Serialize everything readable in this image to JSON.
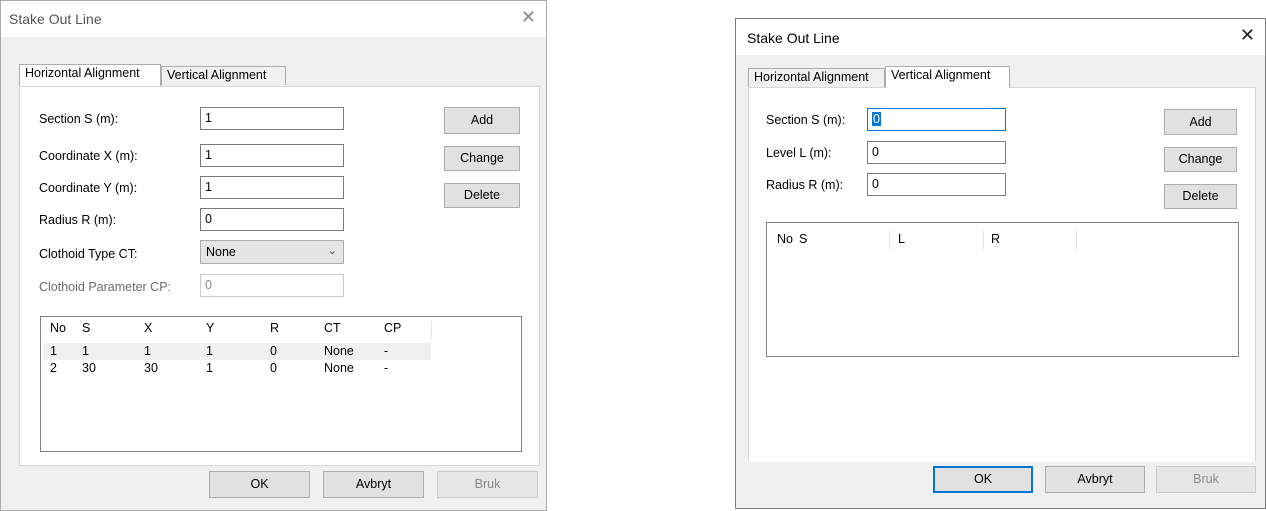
{
  "left": {
    "title": "Stake Out Line",
    "close_glyph": "✕",
    "tabs": [
      "Horizontal Alignment",
      "Vertical Alignment"
    ],
    "fields": {
      "section_label": "Section S (m):",
      "section_value": "1",
      "cx_label": "Coordinate X (m):",
      "cx_value": "1",
      "cy_label": "Coordinate Y (m):",
      "cy_value": "1",
      "radius_label": "Radius R (m):",
      "radius_value": "0",
      "ct_label": "Clothoid Type CT:",
      "ct_value": "None",
      "cp_label": "Clothoid Parameter CP:",
      "cp_value": "0"
    },
    "buttons": {
      "add": "Add",
      "change": "Change",
      "delete": "Delete"
    },
    "table": {
      "columns": [
        "No",
        "S",
        "X",
        "Y",
        "R",
        "CT",
        "CP"
      ],
      "rows": [
        [
          "1",
          "1",
          "1",
          "1",
          "0",
          "None",
          "-"
        ],
        [
          "2",
          "30",
          "30",
          "1",
          "0",
          "None",
          "-"
        ]
      ]
    },
    "footer": {
      "ok": "OK",
      "cancel": "Avbryt",
      "apply": "Bruk"
    }
  },
  "right": {
    "title": "Stake Out Line",
    "close_glyph": "✕",
    "tabs": [
      "Horizontal Alignment",
      "Vertical Alignment"
    ],
    "fields": {
      "section_label": "Section S (m):",
      "section_value": "0",
      "level_label": "Level L (m):",
      "level_value": "0",
      "radius_label": "Radius R (m):",
      "radius_value": "0"
    },
    "buttons": {
      "add": "Add",
      "change": "Change",
      "delete": "Delete"
    },
    "table": {
      "columns": [
        "No",
        "S",
        "L",
        "R"
      ]
    },
    "footer": {
      "ok": "OK",
      "cancel": "Avbryt",
      "apply": "Bruk"
    }
  },
  "colors": {
    "accent": "#0078d7",
    "dialog_bg": "#f0f0f0",
    "panel_bg": "#ffffff"
  }
}
